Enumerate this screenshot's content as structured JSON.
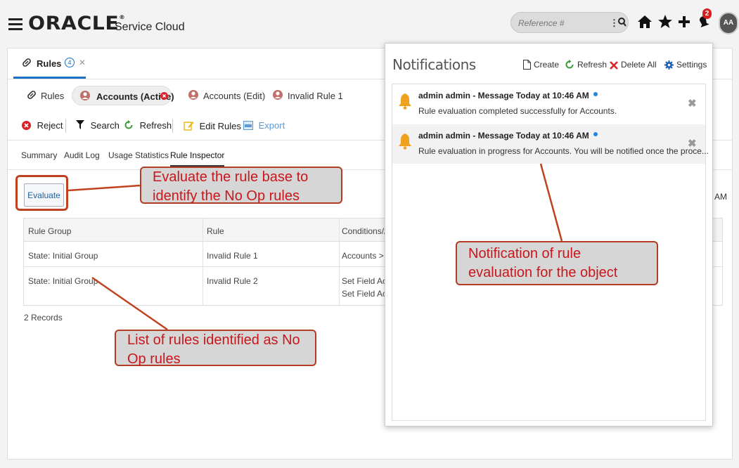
{
  "header": {
    "logo_text": "ORACLE",
    "product_name": "Service Cloud",
    "reference_placeholder": "Reference #",
    "notification_count": "2",
    "avatar_initials": "AA"
  },
  "workspace_tab": {
    "label": "Rules",
    "count": "4"
  },
  "subtabs": [
    {
      "label": "Rules"
    },
    {
      "label": "Accounts (Active)"
    },
    {
      "label": "Accounts (Edit)"
    },
    {
      "label": "Invalid Rule 1"
    }
  ],
  "toolbar": {
    "reject": "Reject",
    "search": "Search",
    "refresh": "Refresh",
    "edit_rules": "Edit Rules",
    "export": "Export"
  },
  "nav": {
    "summary": "Summary",
    "audit_log": "Audit Log",
    "usage_statistics": "Usage Statistics",
    "rule_inspector": "Rule Inspector"
  },
  "inspector": {
    "evaluate_label": "Evaluate",
    "timestamp_fragment": "AM",
    "columns": [
      "Rule Group",
      "Rule",
      "Conditions/Act"
    ],
    "rows": [
      {
        "group": "State: Initial Group",
        "rule": "Invalid Rule 1",
        "conditions": [
          "Accounts > Co"
        ]
      },
      {
        "group": "State: Initial Group",
        "rule": "Invalid Rule 2",
        "conditions": [
          "Set Field Accou",
          "Set Field Accou"
        ]
      }
    ],
    "records_text": "2 Records"
  },
  "notifications": {
    "title": "Notifications",
    "create": "Create",
    "refresh": "Refresh",
    "delete_all": "Delete All",
    "settings": "Settings",
    "items": [
      {
        "header": "admin admin - Message Today at 10:46 AM",
        "body": "Rule evaluation completed successfully for Accounts."
      },
      {
        "header": "admin admin - Message Today at 10:46 AM",
        "body": "Rule evaluation in progress for Accounts. You will be notified once the proce..."
      }
    ]
  },
  "callouts": {
    "evaluate": "Evaluate the rule base to identify the No Op rules",
    "rules_list": "List of rules identified as No Op rules",
    "notification": "Notification of rule evaluation for the object"
  },
  "colors": {
    "accent": "#1a73c8",
    "annotation_border": "#b23d24",
    "annotation_text": "#c8171d",
    "bell": "#f0a21e"
  }
}
